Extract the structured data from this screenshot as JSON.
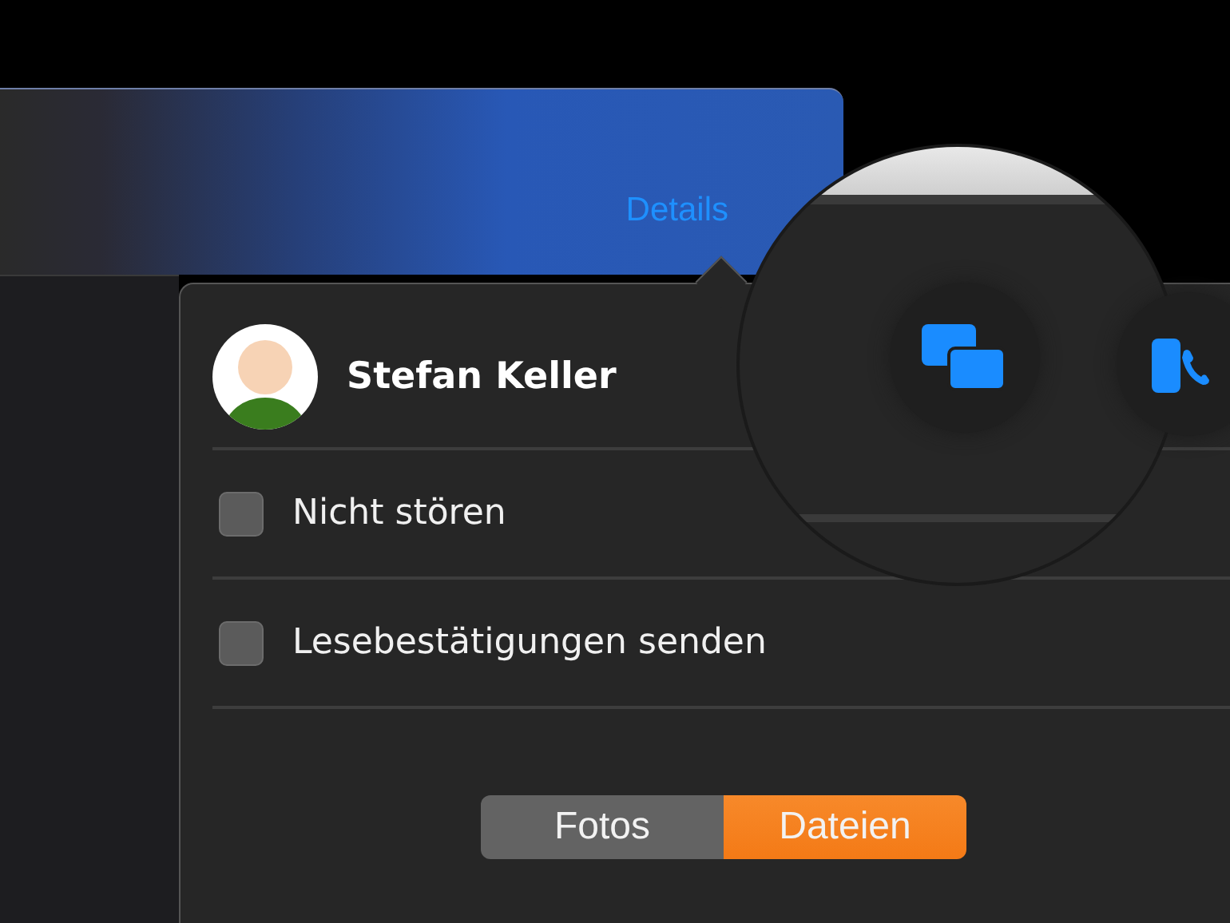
{
  "header": {
    "details_link": "Details"
  },
  "contact": {
    "name": "Stefan Keller"
  },
  "options": [
    {
      "label": "Nicht stören",
      "checked": false
    },
    {
      "label": "Lesebestätigungen senden",
      "checked": false
    }
  ],
  "segments": [
    {
      "label": "Fotos",
      "selected": false
    },
    {
      "label": "Dateien",
      "selected": true
    }
  ],
  "magnifier": {
    "actions": [
      {
        "kind": "messages"
      },
      {
        "kind": "phone"
      }
    ]
  }
}
